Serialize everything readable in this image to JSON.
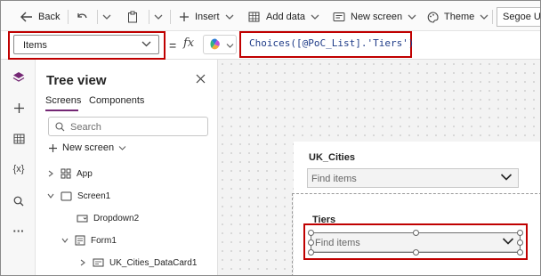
{
  "toolbar": {
    "back_label": "Back",
    "insert_label": "Insert",
    "add_data_label": "Add data",
    "new_screen_label": "New screen",
    "theme_label": "Theme",
    "font_value": "Segoe UI"
  },
  "formula_bar": {
    "property_selected": "Items",
    "equals": "=",
    "fx_label": "fx",
    "formula": "Choices([@PoC_List].'Tiers')"
  },
  "left_rail": {
    "icons": [
      "tree-view-icon",
      "insert-icon",
      "data-icon",
      "variables-icon",
      "search-icon",
      "more-icon"
    ],
    "variables_glyph": "{x}",
    "more_glyph": "···"
  },
  "tree_view": {
    "title": "Tree view",
    "tabs": [
      "Screens",
      "Components"
    ],
    "active_tab": "Screens",
    "search_placeholder": "Search",
    "new_screen_label": "New screen",
    "nodes": [
      {
        "label": "App",
        "expanded": false
      },
      {
        "label": "Screen1",
        "expanded": true
      },
      {
        "label": "Dropdown2",
        "expanded": false
      },
      {
        "label": "Form1",
        "expanded": true
      },
      {
        "label": "UK_Cities_DataCard1",
        "expanded": false
      }
    ]
  },
  "canvas": {
    "card1": {
      "label": "UK_Cities",
      "placeholder": "Find items"
    },
    "card2": {
      "label": "Tiers",
      "placeholder": "Find items"
    }
  },
  "colors": {
    "accent": "#742774",
    "highlight": "#c00000",
    "formula_text": "#1f3c88"
  }
}
